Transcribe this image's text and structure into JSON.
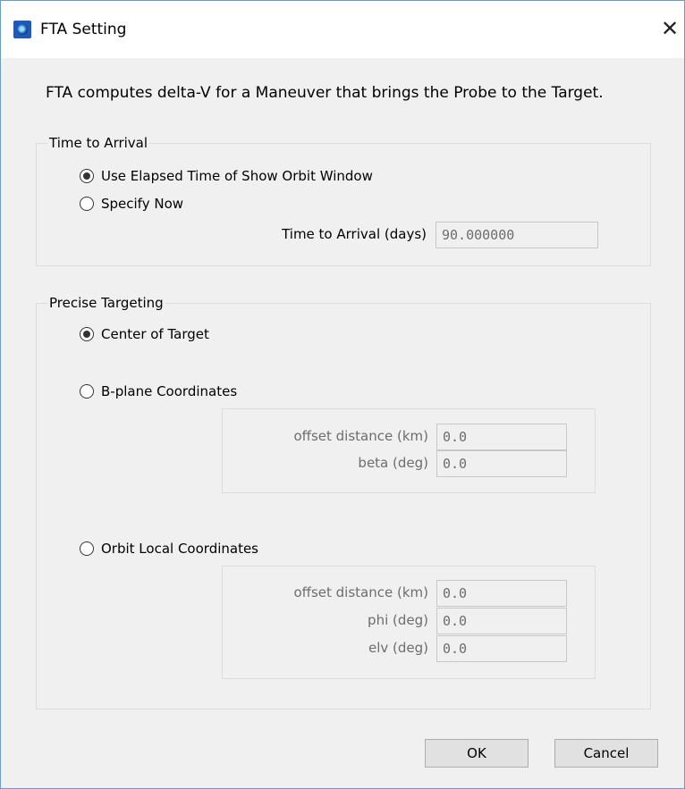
{
  "window": {
    "title": "FTA Setting",
    "icon": "app-globe-icon",
    "close_icon": "close-icon",
    "close_glyph": "✕"
  },
  "description": "FTA computes delta-V for a Maneuver that brings the Probe to the Target.",
  "time_to_arrival": {
    "legend": "Time to Arrival",
    "options": [
      {
        "label": "Use Elapsed Time of Show Orbit Window",
        "checked": true
      },
      {
        "label": "Specify Now",
        "checked": false
      }
    ],
    "field_label": "Time to Arrival (days)",
    "field_value": "90.000000"
  },
  "precise_targeting": {
    "legend": "Precise Targeting",
    "center": {
      "label": "Center of Target",
      "checked": true
    },
    "bplane": {
      "label": "B-plane Coordinates",
      "checked": false,
      "offset_label": "offset distance (km)",
      "offset_value": "0.0",
      "beta_label": "beta (deg)",
      "beta_value": "0.0"
    },
    "orbit_local": {
      "label": "Orbit Local Coordinates",
      "checked": false,
      "offset_label": "offset distance (km)",
      "offset_value": "0.0",
      "phi_label": "phi (deg)",
      "phi_value": "0.0",
      "elv_label": "elv (deg)",
      "elv_value": "0.0"
    }
  },
  "buttons": {
    "ok": "OK",
    "cancel": "Cancel"
  },
  "colors": {
    "window_border": "#6b9bd1",
    "dialog_bg": "#f0f0f0",
    "disabled_text": "#6d6d6d"
  }
}
